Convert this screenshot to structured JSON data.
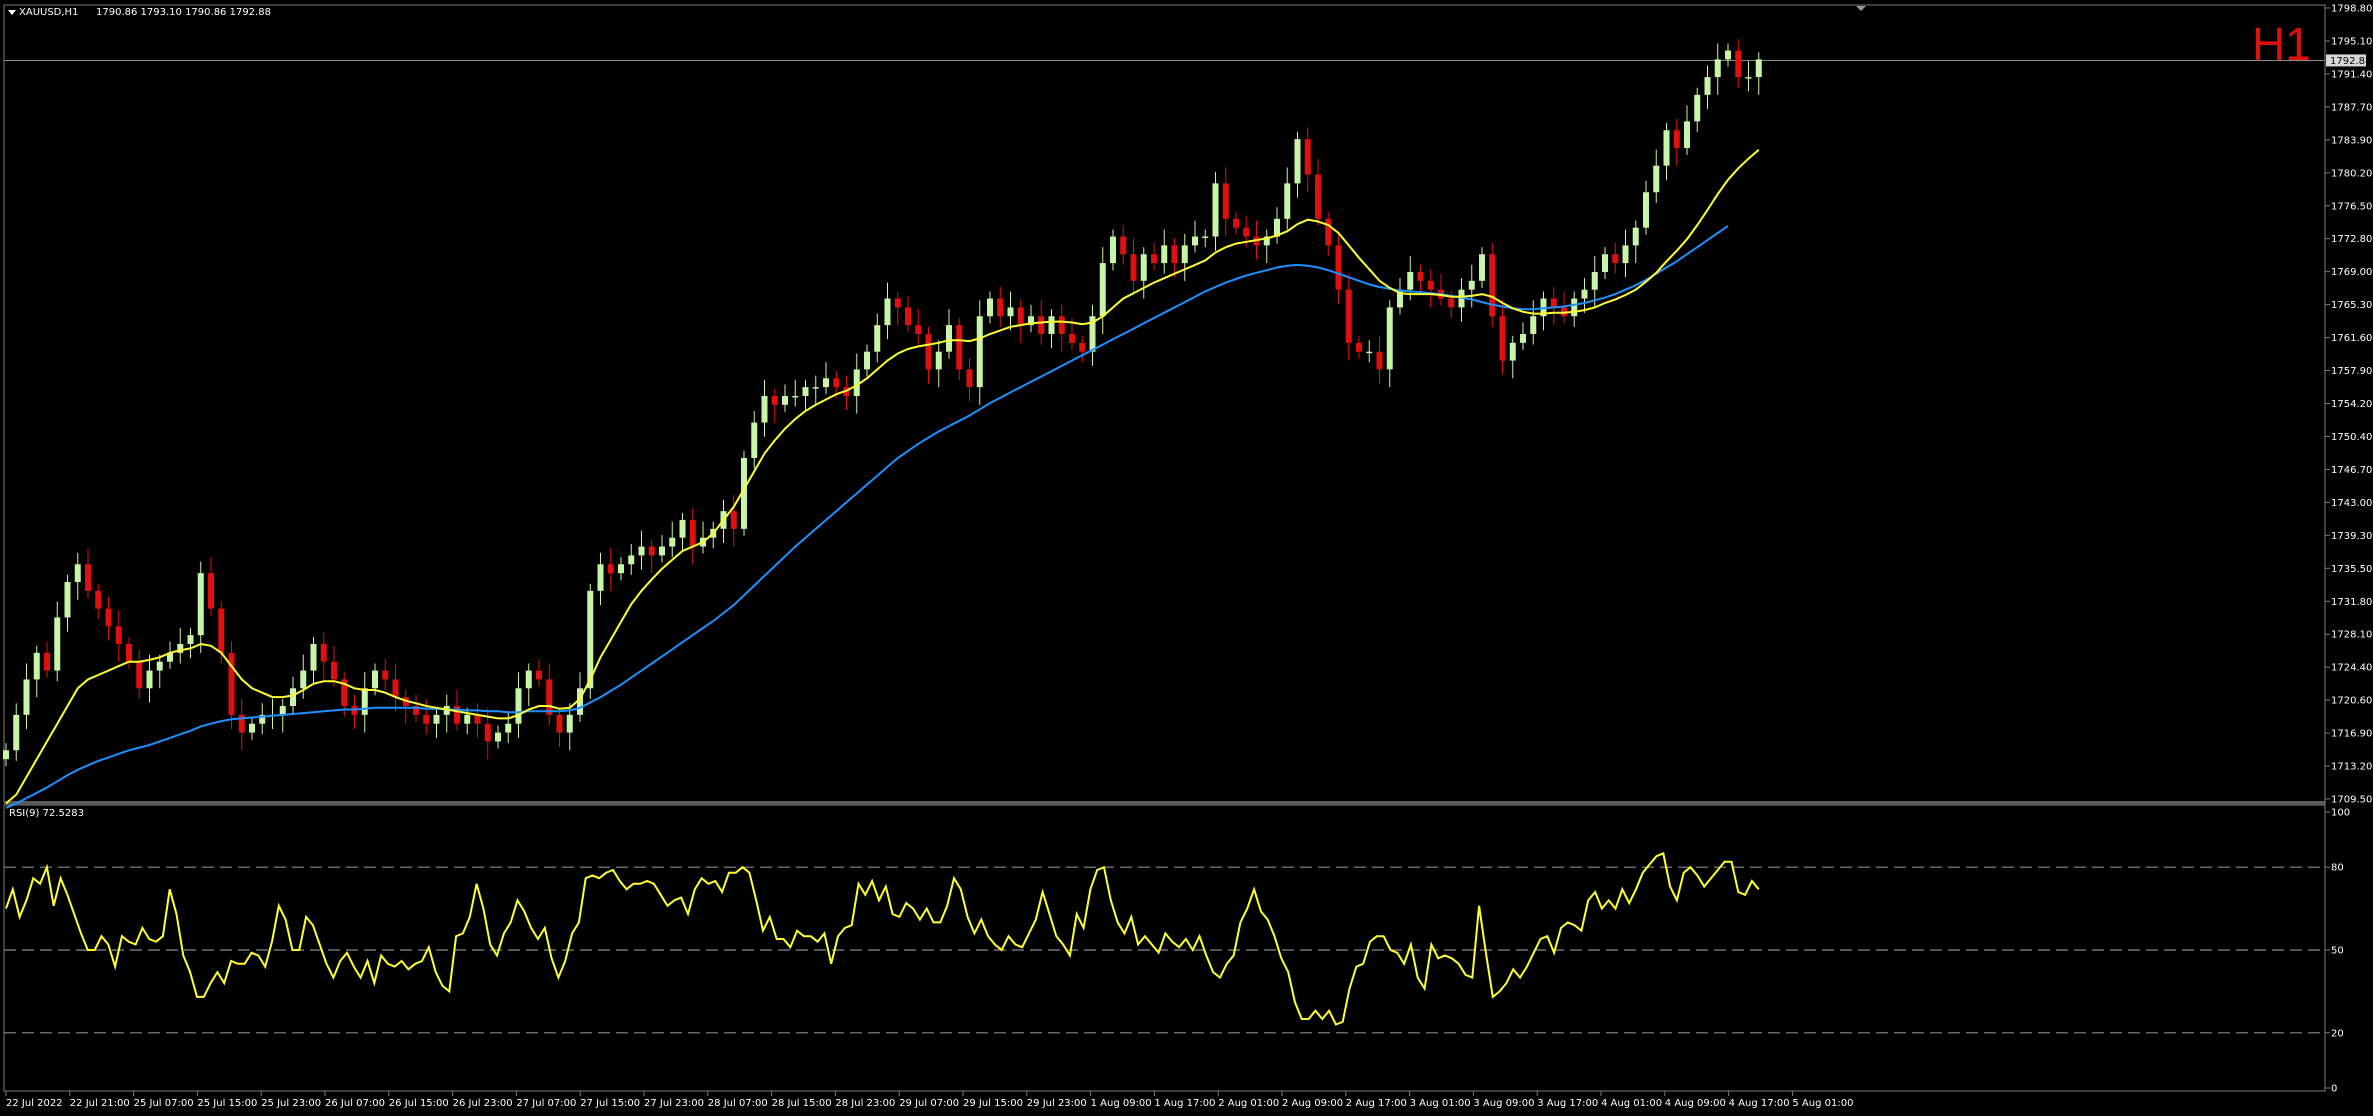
{
  "chart_data": {
    "type": "candlestick",
    "symbol_header": "XAUUSD,H1",
    "ohlc_header": "1790.86 1793.10 1790.86 1792.88",
    "timeframe_label": "H1",
    "current_price_label": "1792.88",
    "price_axis": {
      "range": [
        1709.5,
        1798.8
      ],
      "ticks": [
        "1798.80",
        "1795.10",
        "1791.40",
        "1787.70",
        "1783.90",
        "1780.20",
        "1776.50",
        "1772.80",
        "1769.00",
        "1765.30",
        "1761.60",
        "1757.90",
        "1754.20",
        "1750.40",
        "1746.70",
        "1743.00",
        "1739.30",
        "1735.50",
        "1731.80",
        "1728.10",
        "1724.40",
        "1720.60",
        "1716.90",
        "1713.20",
        "1709.50"
      ]
    },
    "time_axis_labels": [
      "22 Jul 2022",
      "22 Jul 21:00",
      "25 Jul 07:00",
      "25 Jul 15:00",
      "25 Jul 23:00",
      "26 Jul 07:00",
      "26 Jul 15:00",
      "26 Jul 23:00",
      "27 Jul 07:00",
      "27 Jul 15:00",
      "27 Jul 23:00",
      "28 Jul 07:00",
      "28 Jul 15:00",
      "28 Jul 23:00",
      "29 Jul 07:00",
      "29 Jul 15:00",
      "29 Jul 23:00",
      "1 Aug 09:00",
      "1 Aug 17:00",
      "2 Aug 01:00",
      "2 Aug 09:00",
      "2 Aug 17:00",
      "3 Aug 01:00",
      "3 Aug 09:00",
      "3 Aug 17:00",
      "4 Aug 01:00",
      "4 Aug 09:00",
      "4 Aug 17:00",
      "5 Aug 01:00"
    ],
    "close": [
      1715,
      1719,
      1723,
      1726,
      1724,
      1730,
      1734,
      1736,
      1733,
      1731,
      1729,
      1727,
      1725,
      1722,
      1724,
      1725,
      1726,
      1727,
      1728,
      1735,
      1731,
      1726,
      1719,
      1717,
      1718,
      1719,
      1719,
      1720,
      1722,
      1724,
      1727,
      1725,
      1723,
      1720,
      1719,
      1722,
      1724,
      1723,
      1721,
      1720,
      1719,
      1718,
      1719,
      1720,
      1718,
      1719,
      1718,
      1716,
      1717,
      1718,
      1722,
      1724,
      1723,
      1719,
      1717,
      1719,
      1722,
      1733,
      1736,
      1735,
      1736,
      1737,
      1738,
      1737,
      1738,
      1739,
      1741,
      1738,
      1739,
      1740,
      1742,
      1740,
      1748,
      1752,
      1755,
      1754,
      1755,
      1755,
      1756,
      1756,
      1757,
      1756,
      1755,
      1758,
      1760,
      1763,
      1766,
      1765,
      1763,
      1762,
      1758,
      1760,
      1763,
      1758,
      1756,
      1764,
      1766,
      1764,
      1765,
      1763,
      1764,
      1762,
      1764,
      1762,
      1761,
      1760,
      1764,
      1770,
      1773,
      1771,
      1768,
      1771,
      1770,
      1772,
      1770,
      1772,
      1773,
      1773,
      1779,
      1775,
      1774,
      1773,
      1772,
      1773,
      1775,
      1779,
      1784,
      1780,
      1775,
      1772,
      1767,
      1761,
      1760,
      1760,
      1758,
      1765,
      1767,
      1769,
      1768,
      1767,
      1766,
      1765,
      1767,
      1768,
      1771,
      1764,
      1759,
      1761,
      1762,
      1764,
      1766,
      1765,
      1764,
      1766,
      1767,
      1769,
      1771,
      1770,
      1772,
      1774,
      1778,
      1781,
      1785,
      1783,
      1786,
      1789,
      1791,
      1793,
      1794,
      1791,
      1791,
      1793
    ],
    "sma_fast": [
      1709,
      1710,
      1712,
      1714,
      1716,
      1718,
      1720,
      1722,
      1723,
      1723.5,
      1724,
      1724.5,
      1725,
      1725,
      1725.2,
      1725.5,
      1726,
      1726.3,
      1726.5,
      1727,
      1726.8,
      1726,
      1724.5,
      1723,
      1722,
      1721.5,
      1721,
      1721,
      1721.2,
      1721.8,
      1722.5,
      1722.8,
      1722.8,
      1722.5,
      1722,
      1721.8,
      1721.8,
      1721.5,
      1721,
      1720.6,
      1720.3,
      1720,
      1719.8,
      1719.6,
      1719.4,
      1719.2,
      1719,
      1718.8,
      1718.6,
      1718.6,
      1719,
      1719.6,
      1720,
      1720,
      1719.7,
      1719.8,
      1720.8,
      1723,
      1725.5,
      1727.5,
      1729.5,
      1731.5,
      1733,
      1734.3,
      1735.5,
      1736.5,
      1737.5,
      1738,
      1738.5,
      1739.5,
      1741,
      1742.5,
      1744.5,
      1746.5,
      1748.5,
      1750,
      1751.3,
      1752.4,
      1753.3,
      1754,
      1754.6,
      1755.2,
      1755.6,
      1756.2,
      1757,
      1758,
      1759,
      1759.8,
      1760.3,
      1760.6,
      1760.8,
      1761,
      1761.3,
      1761.3,
      1761.2,
      1761.5,
      1762,
      1762.4,
      1762.8,
      1763,
      1763.2,
      1763.3,
      1763.4,
      1763.4,
      1763.3,
      1763.1,
      1763.3,
      1764,
      1765,
      1766,
      1766.6,
      1767.2,
      1767.8,
      1768.3,
      1768.8,
      1769.3,
      1769.8,
      1770.3,
      1771.2,
      1771.8,
      1772.2,
      1772.4,
      1772.6,
      1772.8,
      1773.1,
      1773.6,
      1774.4,
      1774.9,
      1774.7,
      1774.3,
      1773.4,
      1772,
      1770.6,
      1769.3,
      1768,
      1767.2,
      1766.6,
      1766.5,
      1766.5,
      1766.5,
      1766.4,
      1766.2,
      1766.2,
      1766.3,
      1766.5,
      1766.2,
      1765.5,
      1764.9,
      1764.5,
      1764.3,
      1764.3,
      1764.4,
      1764.4,
      1764.5,
      1764.7,
      1765,
      1765.5,
      1765.9,
      1766.4,
      1767,
      1767.9,
      1768.9,
      1770.2,
      1771.4,
      1772.7,
      1774.3,
      1776,
      1777.8,
      1779.4,
      1780.7,
      1781.8,
      1782.8
    ],
    "sma_slow": [
      1708.5,
      1709,
      1709.6,
      1710.2,
      1710.8,
      1711.5,
      1712.2,
      1712.8,
      1713.3,
      1713.8,
      1714.2,
      1714.6,
      1715,
      1715.3,
      1715.6,
      1716,
      1716.4,
      1716.8,
      1717.2,
      1717.7,
      1718,
      1718.3,
      1718.5,
      1718.6,
      1718.7,
      1718.8,
      1718.9,
      1719,
      1719.1,
      1719.2,
      1719.3,
      1719.4,
      1719.5,
      1719.6,
      1719.6,
      1719.7,
      1719.8,
      1719.8,
      1719.8,
      1719.8,
      1719.8,
      1719.7,
      1719.7,
      1719.6,
      1719.6,
      1719.5,
      1719.5,
      1719.4,
      1719.4,
      1719.3,
      1719.3,
      1719.4,
      1719.4,
      1719.4,
      1719.4,
      1719.5,
      1719.8,
      1720.4,
      1721,
      1721.7,
      1722.4,
      1723.2,
      1724,
      1724.8,
      1725.6,
      1726.4,
      1727.2,
      1728,
      1728.8,
      1729.6,
      1730.5,
      1731.4,
      1732.5,
      1733.6,
      1734.7,
      1735.8,
      1736.9,
      1738,
      1739,
      1740,
      1741,
      1742,
      1743,
      1744,
      1745,
      1746,
      1747,
      1748,
      1748.8,
      1749.6,
      1750.3,
      1751,
      1751.6,
      1752.2,
      1752.8,
      1753.5,
      1754.2,
      1754.8,
      1755.4,
      1756,
      1756.6,
      1757.2,
      1757.8,
      1758.4,
      1759,
      1759.6,
      1760.2,
      1760.8,
      1761.4,
      1762,
      1762.6,
      1763.2,
      1763.8,
      1764.4,
      1765,
      1765.6,
      1766.2,
      1766.8,
      1767.3,
      1767.8,
      1768.2,
      1768.6,
      1768.9,
      1769.2,
      1769.5,
      1769.7,
      1769.8,
      1769.7,
      1769.5,
      1769.2,
      1768.8,
      1768.4,
      1768,
      1767.6,
      1767.3,
      1767.1,
      1766.9,
      1766.8,
      1766.7,
      1766.6,
      1766.5,
      1766.3,
      1766.1,
      1765.9,
      1765.6,
      1765.3,
      1765.1,
      1764.9,
      1764.8,
      1764.8,
      1764.9,
      1765,
      1765.1,
      1765.3,
      1765.5,
      1765.8,
      1766.1,
      1766.5,
      1767,
      1767.5,
      1768.1,
      1768.8,
      1769.5,
      1770.2,
      1771,
      1771.8,
      1772.6,
      1773.4,
      1774.2
    ],
    "rsi": {
      "label": "RSI(9) 72.5283",
      "range": [
        0,
        100
      ],
      "levels": [
        80,
        50,
        20
      ],
      "tick_labels": [
        "100",
        "80",
        "50",
        "20",
        "0"
      ],
      "values": [
        65,
        72,
        62,
        68,
        76,
        74,
        80,
        66,
        76,
        70,
        63,
        56,
        50,
        50,
        55,
        52,
        44,
        55,
        53,
        52,
        58,
        54,
        53,
        55,
        72,
        63,
        48,
        42,
        33,
        33,
        38,
        42,
        38,
        46,
        45,
        45,
        49,
        48,
        44,
        53,
        66,
        61,
        50,
        50,
        62,
        59,
        52,
        45,
        40,
        46,
        49,
        44,
        40,
        46,
        38,
        48,
        45,
        44,
        46,
        43,
        45,
        46,
        51,
        42,
        37,
        35,
        55,
        56,
        62,
        74,
        65,
        52,
        48,
        56,
        60,
        68,
        64,
        58,
        54,
        58,
        47,
        40,
        46,
        56,
        60,
        76,
        77,
        76,
        78,
        79,
        75,
        72,
        74,
        74,
        75,
        74,
        70,
        66,
        68,
        69,
        63,
        72,
        76,
        74,
        75,
        71,
        78,
        78,
        80,
        78,
        68,
        57,
        62,
        54,
        54,
        51,
        57,
        55,
        55,
        53,
        56,
        45,
        55,
        58,
        59,
        74,
        70,
        75,
        68,
        73,
        63,
        62,
        67,
        65,
        61,
        65,
        60,
        60,
        66,
        76,
        72,
        62,
        56,
        61,
        55,
        52,
        50,
        55,
        52,
        51,
        56,
        61,
        71,
        63,
        55,
        52,
        48,
        63,
        58,
        72,
        79,
        80,
        68,
        60,
        56,
        62,
        52,
        55,
        52,
        49,
        56,
        53,
        51,
        54,
        50,
        55,
        48,
        42,
        40,
        45,
        48,
        60,
        65,
        72,
        64,
        61,
        55,
        47,
        42,
        31,
        25,
        25,
        28,
        25,
        28,
        23,
        24,
        36,
        44,
        45,
        53,
        55,
        55,
        50,
        49,
        45,
        52,
        40,
        36,
        52,
        47,
        48,
        47,
        45,
        41,
        40,
        66,
        49,
        33,
        35,
        38,
        43,
        40,
        44,
        49,
        54,
        55,
        49,
        58,
        60,
        59,
        57,
        68,
        71,
        65,
        68,
        65,
        72,
        67,
        72,
        78,
        81,
        84,
        85,
        73,
        68,
        78,
        80,
        77,
        73,
        76,
        79,
        82,
        82,
        71,
        70,
        75,
        72
      ]
    }
  }
}
